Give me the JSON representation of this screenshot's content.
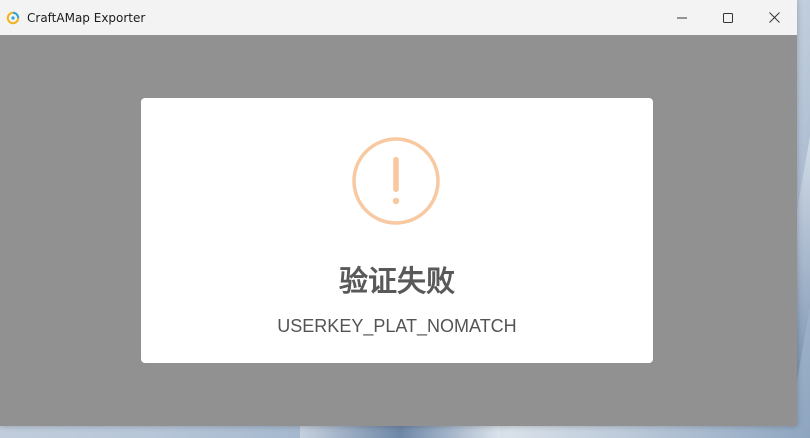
{
  "window": {
    "title": "CraftAMap Exporter"
  },
  "dialog": {
    "title": "验证失败",
    "message": "USERKEY_PLAT_NOMATCH",
    "icon": "warning-icon",
    "icon_color": "#f8c9a0"
  },
  "colors": {
    "overlay": "#919191",
    "dialog_bg": "#ffffff",
    "titlebar_bg": "#f3f3f3"
  }
}
